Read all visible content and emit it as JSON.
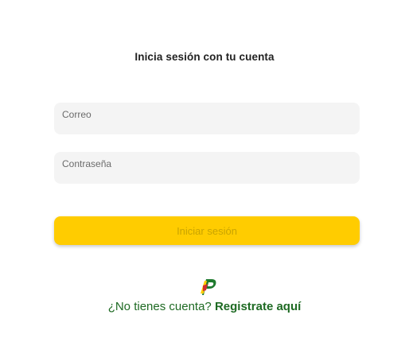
{
  "heading": "Inicia sesión con tu cuenta",
  "form": {
    "email_placeholder": "Correo",
    "password_placeholder": "Contraseña",
    "submit_label": "Iniciar sesión"
  },
  "footer": {
    "logo_icon": "brand-p-logo-icon",
    "prompt": "¿No tienes cuenta?",
    "signup_link": "Registrate aquí"
  },
  "colors": {
    "accent": "#ffcc00",
    "link": "#1e6a23",
    "field_bg": "#f4f4f4"
  }
}
